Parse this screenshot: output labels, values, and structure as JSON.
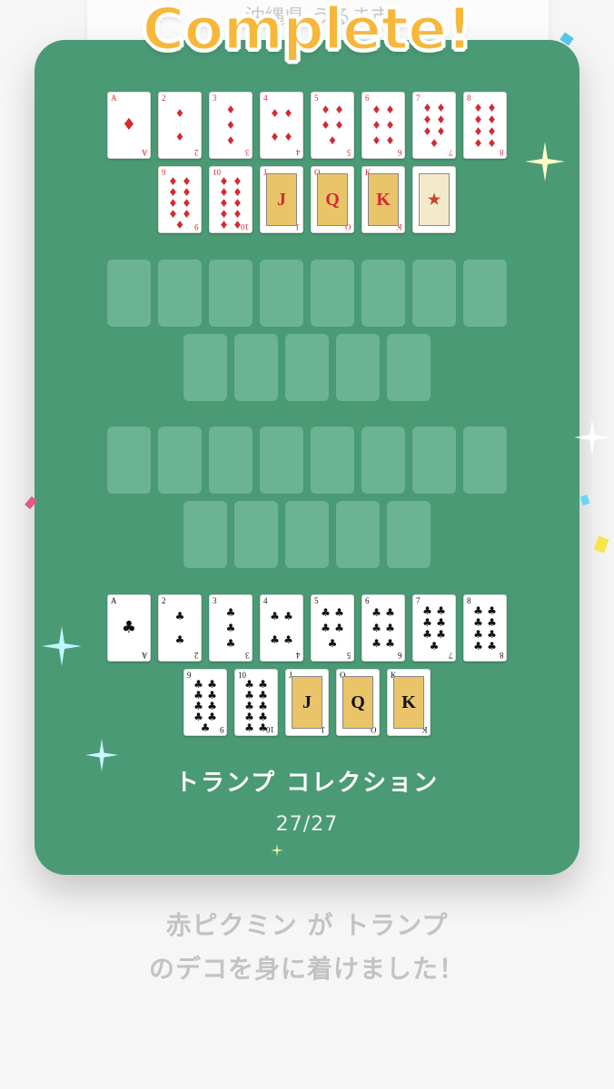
{
  "background_card": {
    "text": "沖縄県 うるま市"
  },
  "banner": {
    "text": "Complete!"
  },
  "diamonds_row1": [
    {
      "rank": "A",
      "suit": "♦",
      "pips": 1
    },
    {
      "rank": "2",
      "suit": "♦",
      "pips": 2
    },
    {
      "rank": "3",
      "suit": "♦",
      "pips": 3
    },
    {
      "rank": "4",
      "suit": "♦",
      "pips": 4
    },
    {
      "rank": "5",
      "suit": "♦",
      "pips": 5
    },
    {
      "rank": "6",
      "suit": "♦",
      "pips": 6
    },
    {
      "rank": "7",
      "suit": "♦",
      "pips": 7
    },
    {
      "rank": "8",
      "suit": "♦",
      "pips": 8
    }
  ],
  "diamonds_row2": [
    {
      "rank": "9",
      "suit": "♦",
      "pips": 9
    },
    {
      "rank": "10",
      "suit": "♦",
      "pips": 10
    },
    {
      "rank": "J",
      "suit": "♦",
      "face": true
    },
    {
      "rank": "Q",
      "suit": "♦",
      "face": true
    },
    {
      "rank": "K",
      "suit": "♦",
      "face": true
    },
    {
      "rank": "JOKER",
      "suit": "",
      "joker": true
    }
  ],
  "clubs_row1": [
    {
      "rank": "A",
      "suit": "♣",
      "pips": 1
    },
    {
      "rank": "2",
      "suit": "♣",
      "pips": 2
    },
    {
      "rank": "3",
      "suit": "♣",
      "pips": 3
    },
    {
      "rank": "4",
      "suit": "♣",
      "pips": 4
    },
    {
      "rank": "5",
      "suit": "♣",
      "pips": 5
    },
    {
      "rank": "6",
      "suit": "♣",
      "pips": 6
    },
    {
      "rank": "7",
      "suit": "♣",
      "pips": 7
    },
    {
      "rank": "8",
      "suit": "♣",
      "pips": 8
    }
  ],
  "clubs_row2": [
    {
      "rank": "9",
      "suit": "♣",
      "pips": 9
    },
    {
      "rank": "10",
      "suit": "♣",
      "pips": 10
    },
    {
      "rank": "J",
      "suit": "♣",
      "face": true
    },
    {
      "rank": "Q",
      "suit": "♣",
      "face": true
    },
    {
      "rank": "K",
      "suit": "♣",
      "face": true
    }
  ],
  "collection": {
    "title": "トランプ コレクション",
    "count": "27/27"
  },
  "message": {
    "line1": "赤ピクミン が トランプ",
    "line2": "のデコを身に着けました！"
  },
  "colors": {
    "panel": "#4a9a75",
    "slot_empty": "#6cb294",
    "banner": "#f7b73a",
    "red_suit": "#d22c33"
  },
  "icons": {
    "sparkle": "sparkle-icon",
    "confetti": "confetti-piece"
  }
}
